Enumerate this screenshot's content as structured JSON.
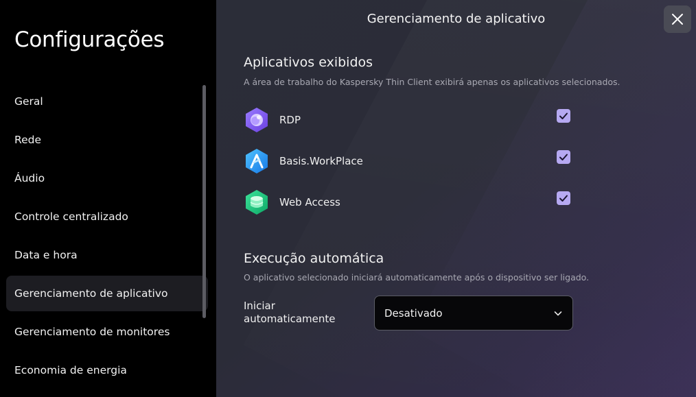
{
  "sidebar": {
    "title": "Configurações",
    "items": [
      {
        "label": "Geral",
        "active": false
      },
      {
        "label": "Rede",
        "active": false
      },
      {
        "label": "Áudio",
        "active": false
      },
      {
        "label": "Controle centralizado",
        "active": false
      },
      {
        "label": "Data e hora",
        "active": false
      },
      {
        "label": "Gerenciamento de aplicativo",
        "active": true
      },
      {
        "label": "Gerenciamento de monitores",
        "active": false
      },
      {
        "label": "Economia de energia",
        "active": false
      }
    ]
  },
  "main": {
    "title": "Gerenciamento de aplicativo",
    "close_icon": "close-icon",
    "displayed_apps": {
      "heading": "Aplicativos exibidos",
      "description": "A área de trabalho do Kaspersky Thin Client exibirá apenas os aplicativos selecionados.",
      "apps": [
        {
          "name": "RDP",
          "icon": "rdp-icon",
          "checked": true
        },
        {
          "name": "Basis.WorkPlace",
          "icon": "basis-workplace-icon",
          "checked": true
        },
        {
          "name": "Web Access",
          "icon": "web-access-icon",
          "checked": true
        }
      ]
    },
    "autorun": {
      "heading": "Execução automática",
      "description": "O aplicativo selecionado iniciará automaticamente após o dispositivo ser ligado.",
      "field_label": "Iniciar automaticamente",
      "selected_value": "Desativado"
    }
  },
  "colors": {
    "accent": "#b6a9f2",
    "sidebar_bg": "#000000",
    "main_bg": "#2b2c38",
    "active_item_bg": "#1d1d22"
  }
}
